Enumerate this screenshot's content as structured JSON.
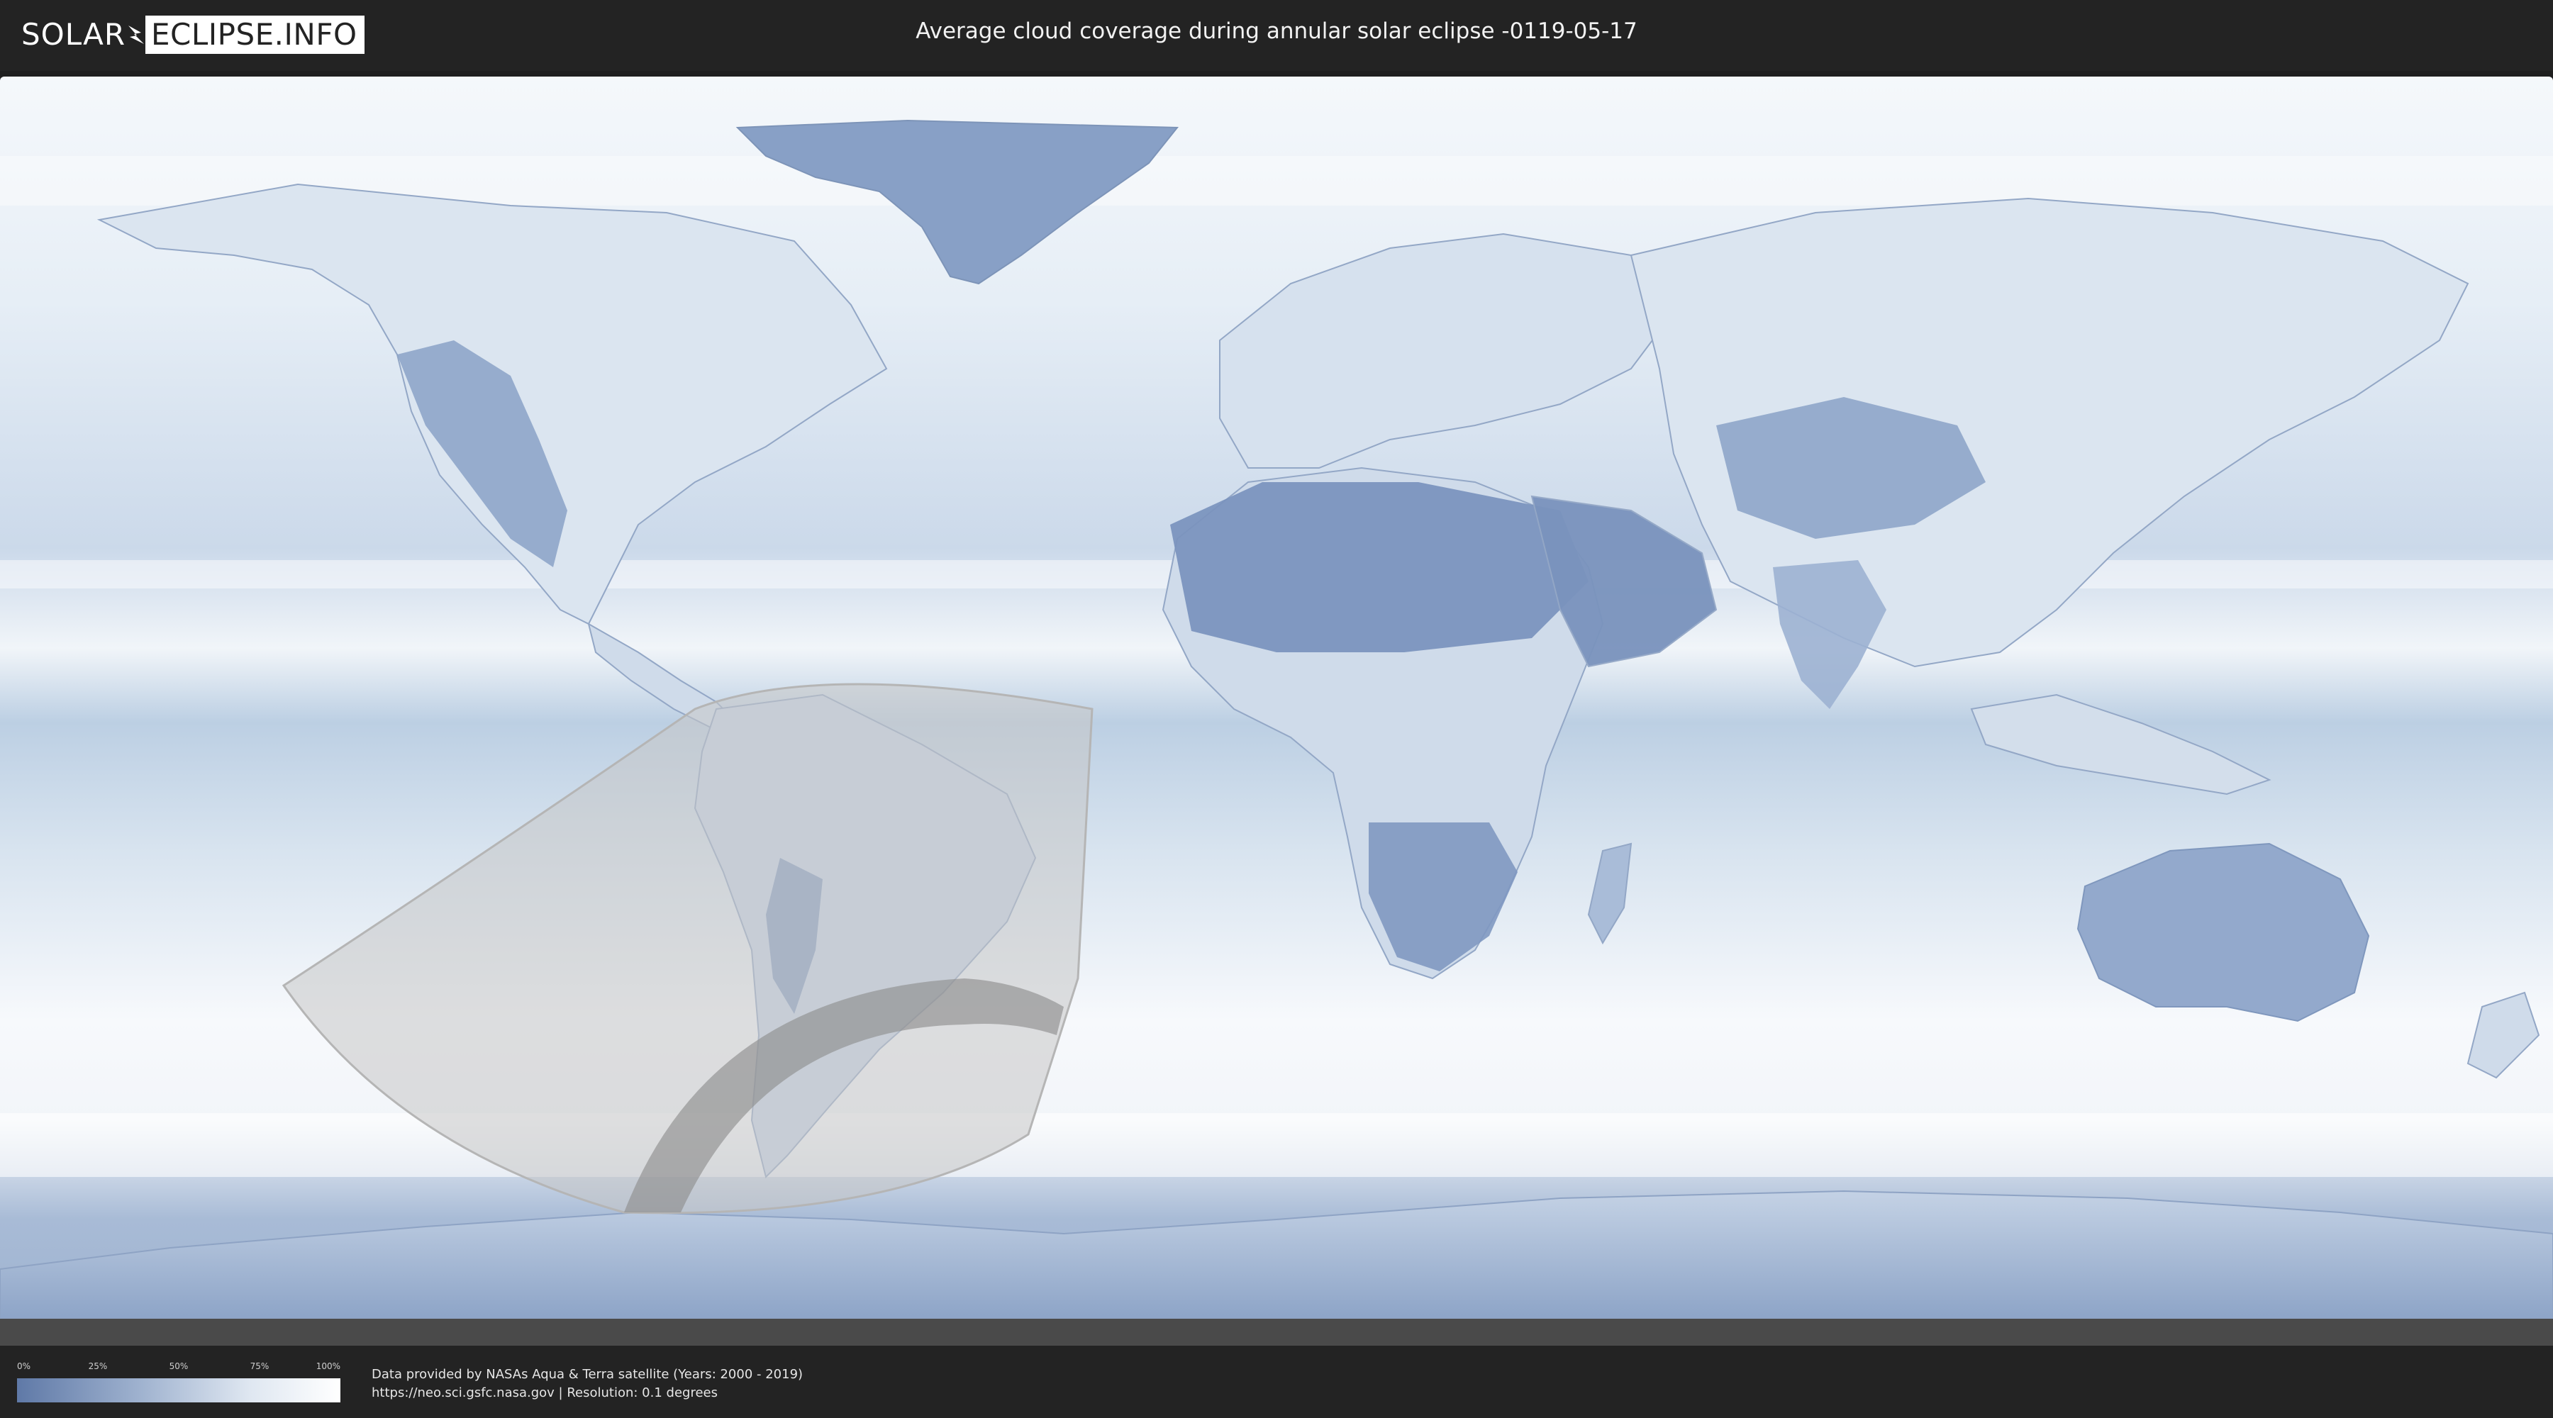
{
  "header": {
    "logo_left": "SOLAR",
    "logo_right": "ECLIPSE.INFO",
    "title": "Average cloud coverage during annular solar eclipse -0119-05-17"
  },
  "legend": {
    "ticks": [
      "0%",
      "25%",
      "50%",
      "75%",
      "100%"
    ],
    "low_color": "#5f79a7",
    "high_color": "#ffffff"
  },
  "footer": {
    "credit_line1": "Data provided by NASAs Aqua & Terra satellite (Years: 2000 - 2019)",
    "credit_line2": "https://neo.sci.gsfc.nasa.gov | Resolution: 0.1 degrees"
  },
  "map": {
    "ocean_color": "#e3ebf4",
    "land_cloudy_color": "#eef3f8",
    "land_clear_color": "#7f97c0",
    "eclipse_zone_color": "#cfcfcf",
    "annularity_path_color": "#9d9d9d"
  }
}
